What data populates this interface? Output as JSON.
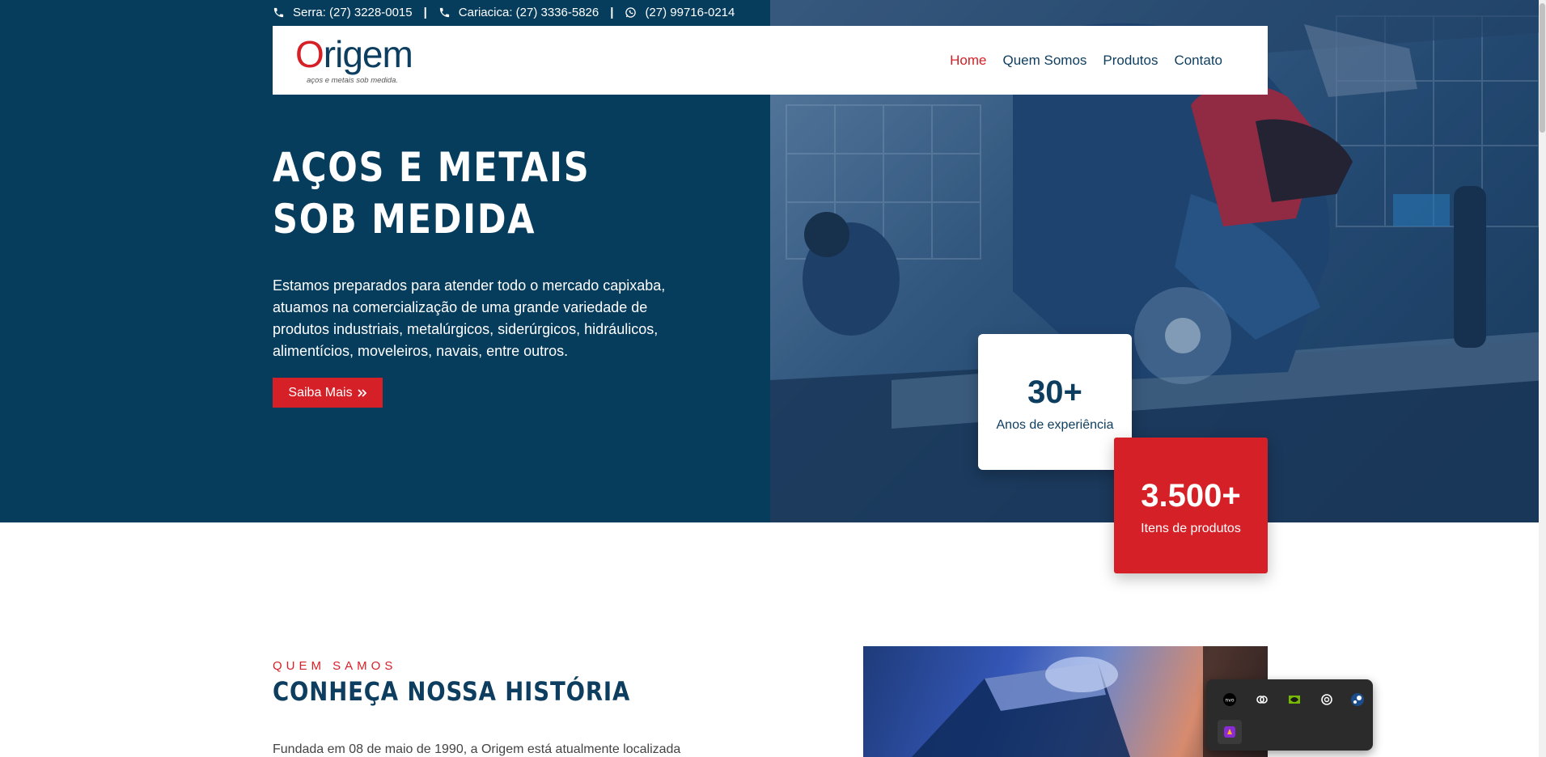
{
  "topbar": {
    "phone1": "Serra: (27) 3228-0015",
    "phone2": "Cariacica: (27) 3336-5826",
    "whatsapp": "(27) 99716-0214",
    "separator": "|"
  },
  "logo": {
    "name": "Origem",
    "tagline": "aços e metais sob medida."
  },
  "nav": {
    "items": [
      {
        "label": "Home",
        "active": true
      },
      {
        "label": "Quem Somos",
        "active": false
      },
      {
        "label": "Produtos",
        "active": false
      },
      {
        "label": "Contato",
        "active": false
      }
    ]
  },
  "hero": {
    "title": "AÇOS E METAIS SOB MEDIDA",
    "description": "Estamos preparados para atender todo o mercado capixaba, atuamos na comercialização de uma grande variedade de produtos industriais, metalúrgicos, siderúrgicos, hidráulicos, alimentícios, moveleiros, navais, entre outros.",
    "button_label": "Saiba Mais",
    "button_icon": "double-chevron-right-icon"
  },
  "stats": [
    {
      "value": "30+",
      "label": "Anos de experiência"
    },
    {
      "value": "3.500+",
      "label": "Itens de produtos"
    }
  ],
  "about": {
    "eyebrow": "QUEM SAMOS",
    "title": "CONHEÇA NOSSA HISTÓRIA",
    "text": "Fundada em 08 de maio de 1990, a Origem está atualmente localizada"
  },
  "tray": {
    "icons": [
      "nvidia-app-icon",
      "link-icon",
      "nvidia-icon",
      "chatgpt-icon",
      "steam-icon",
      "app-icon"
    ]
  },
  "colors": {
    "navy": "#063c5c",
    "brand_red": "#d52027",
    "text_navy": "#0d3d5f"
  }
}
